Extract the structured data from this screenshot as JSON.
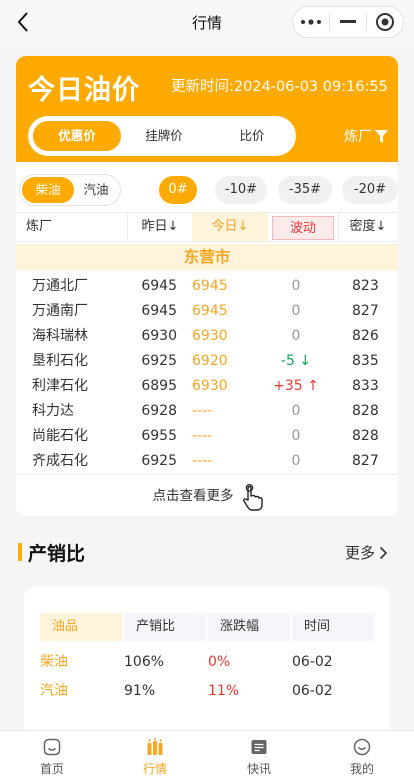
{
  "navbar": {
    "title": "行情"
  },
  "oil_card": {
    "title": "今日油价",
    "update_time": "更新时间:2024-06-03 09:16:55",
    "tabs": [
      "优惠价",
      "挂牌价",
      "比价"
    ],
    "refinery_filter": "炼厂",
    "fuel_types": [
      "柴油",
      "汽油"
    ],
    "grades": [
      "0#",
      "-10#",
      "-35#",
      "-20#"
    ],
    "columns": [
      "炼厂",
      "昨日↓",
      "今日↓",
      "波动",
      "密度↓"
    ],
    "city": "东营市",
    "rows": [
      {
        "name": "万通北厂",
        "yesterday": "6945",
        "today": "6945",
        "change": "0",
        "density": "823"
      },
      {
        "name": "万通南厂",
        "yesterday": "6945",
        "today": "6945",
        "change": "0",
        "density": "827"
      },
      {
        "name": "海科瑞林",
        "yesterday": "6930",
        "today": "6930",
        "change": "0",
        "density": "826"
      },
      {
        "name": "垦利石化",
        "yesterday": "6925",
        "today": "6920",
        "change": "-5 ↓",
        "density": "835"
      },
      {
        "name": "利津石化",
        "yesterday": "6895",
        "today": "6930",
        "change": "+35 ↑",
        "density": "833"
      },
      {
        "name": "科力达",
        "yesterday": "6928",
        "today": "----",
        "change": "0",
        "density": "828"
      },
      {
        "name": "尚能石化",
        "yesterday": "6955",
        "today": "----",
        "change": "0",
        "density": "828"
      },
      {
        "name": "齐成石化",
        "yesterday": "6925",
        "today": "----",
        "change": "0",
        "density": "827"
      }
    ],
    "view_more": "点击查看更多"
  },
  "production_sales": {
    "title": "产销比",
    "more": "更多",
    "columns": [
      "油品",
      "产销比",
      "涨跌幅",
      "时间"
    ],
    "rows": [
      {
        "fuel": "柴油",
        "ratio": "106%",
        "change": "0%",
        "date": "06-02"
      },
      {
        "fuel": "汽油",
        "ratio": "91%",
        "change": "11%",
        "date": "06-02"
      }
    ]
  },
  "tabbar": {
    "items": [
      "首页",
      "行情",
      "快讯",
      "我的"
    ]
  },
  "colors": {
    "accent": "#ffaa00",
    "up": "#e53935",
    "down": "#1aa05a"
  }
}
